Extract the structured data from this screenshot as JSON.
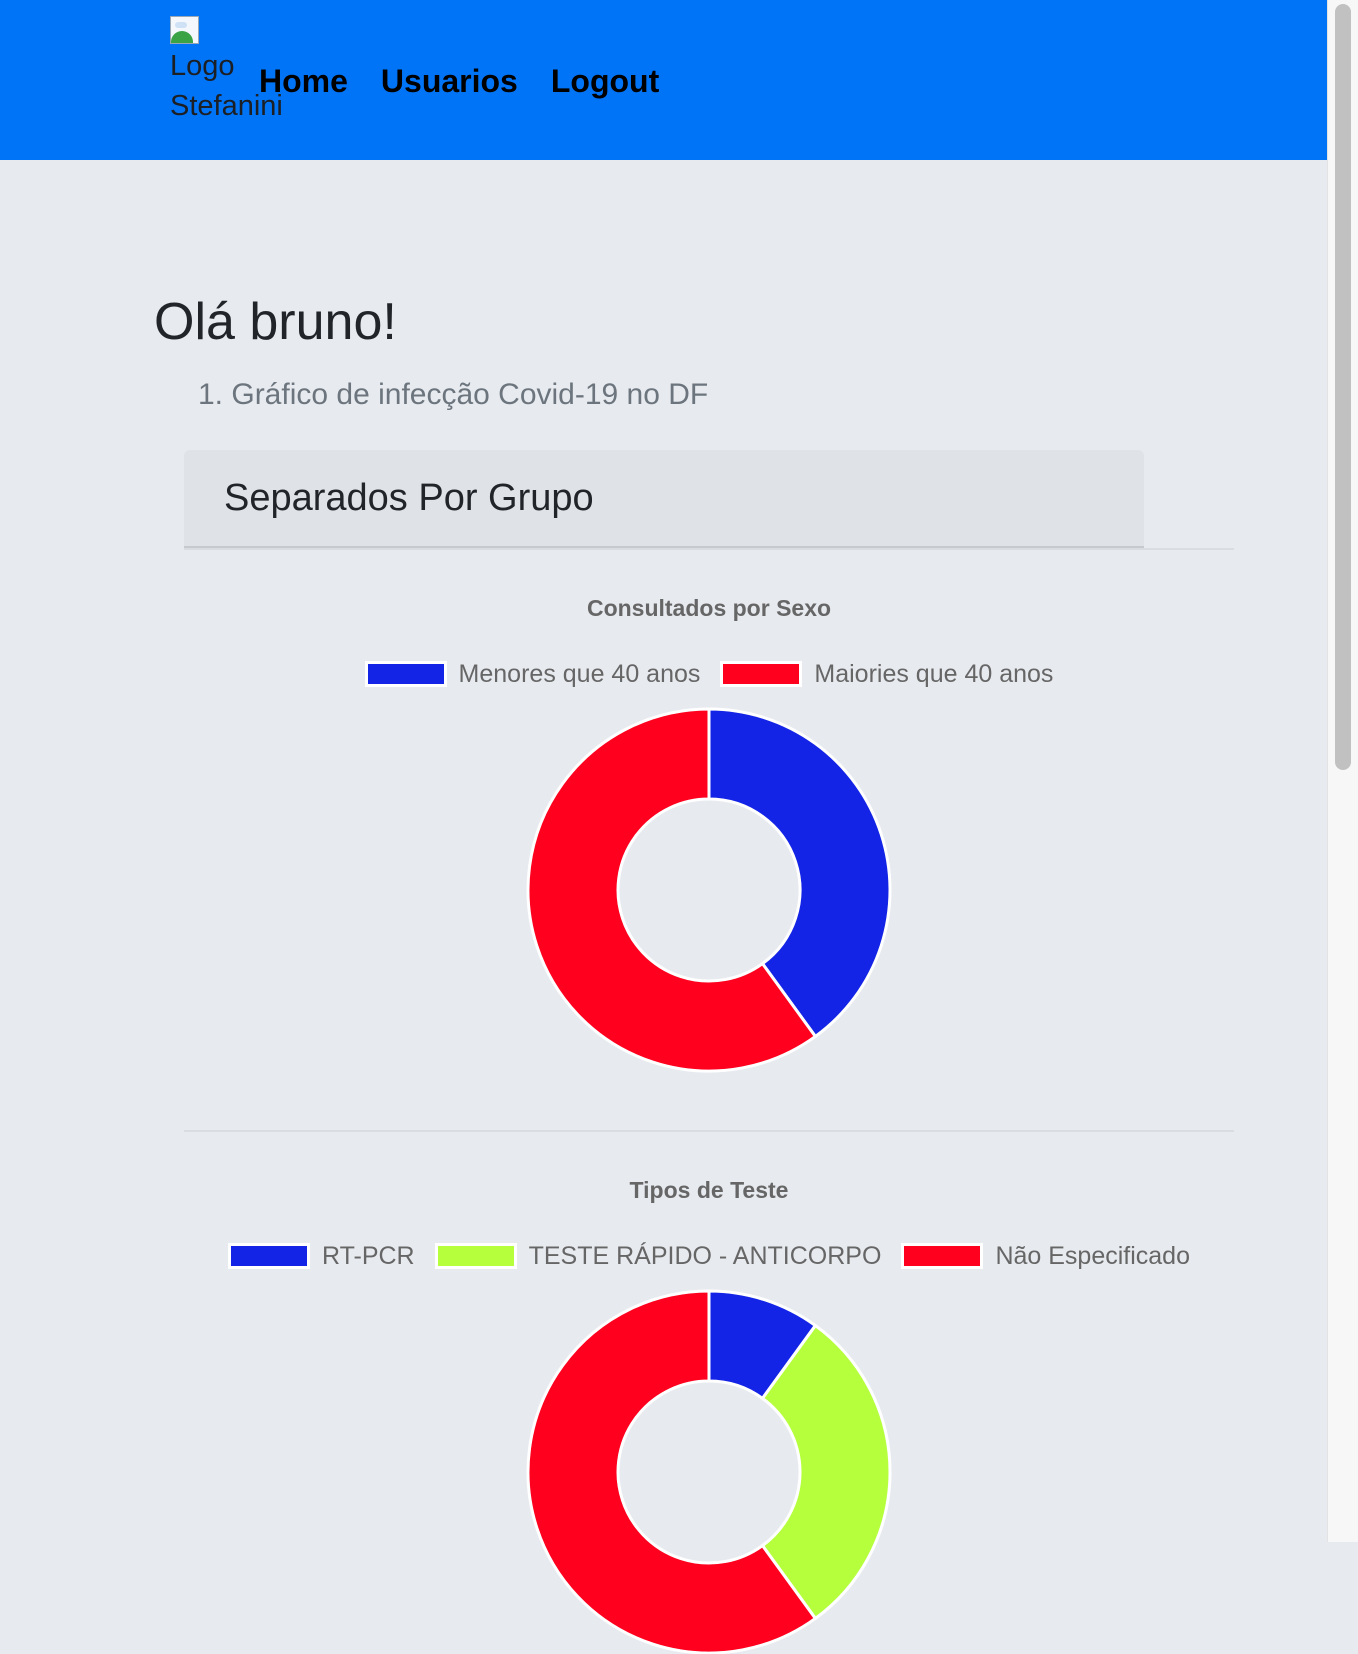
{
  "navbar": {
    "logo_alt": "Logo Stefanini",
    "links": [
      {
        "label": "Home"
      },
      {
        "label": "Usuarios"
      },
      {
        "label": "Logout"
      }
    ],
    "background": "#0074f7"
  },
  "main": {
    "greeting": "Olá bruno!",
    "list_item": "1. Gráfico de infecção Covid-19 no DF",
    "card_title": "Separados Por Grupo"
  },
  "chart_data": [
    {
      "type": "pie",
      "title": "Consultados por Sexo",
      "labels": [
        "Menores que 40 anos",
        "Maiories que 40 anos"
      ],
      "values": [
        40,
        60
      ],
      "colors": [
        "#1324e6",
        "#ff001e"
      ],
      "donut": true
    },
    {
      "type": "pie",
      "title": "Tipos de Teste",
      "labels": [
        "RT-PCR",
        "TESTE RÁPIDO - ANTICORPO",
        "Não Especificado"
      ],
      "values": [
        10,
        30,
        60
      ],
      "colors": [
        "#1324e6",
        "#b6ff3d",
        "#ff001e"
      ],
      "donut": true
    }
  ]
}
